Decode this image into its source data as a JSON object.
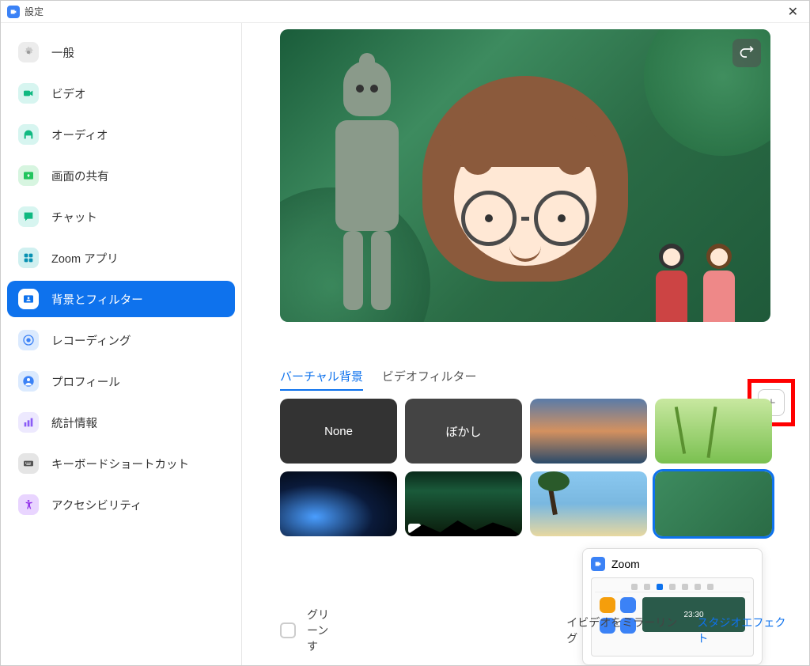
{
  "window": {
    "title": "設定"
  },
  "sidebar": {
    "items": [
      {
        "label": "一般"
      },
      {
        "label": "ビデオ"
      },
      {
        "label": "オーディオ"
      },
      {
        "label": "画面の共有"
      },
      {
        "label": "チャット"
      },
      {
        "label": "Zoom アプリ"
      },
      {
        "label": "背景とフィルター"
      },
      {
        "label": "レコーディング"
      },
      {
        "label": "プロフィール"
      },
      {
        "label": "統計情報"
      },
      {
        "label": "キーボードショートカット"
      },
      {
        "label": "アクセシビリティ"
      }
    ]
  },
  "tabs": {
    "virtual_bg": "バーチャル背景",
    "video_filter": "ビデオフィルター"
  },
  "backgrounds": {
    "none": "None",
    "blur": "ぼかし"
  },
  "popup": {
    "title": "Zoom",
    "time": "23:30"
  },
  "bottom": {
    "greenscreen": "グリーンす",
    "mirror": "イビデオをミラーリング",
    "studio": "スタジオエフェクト"
  }
}
